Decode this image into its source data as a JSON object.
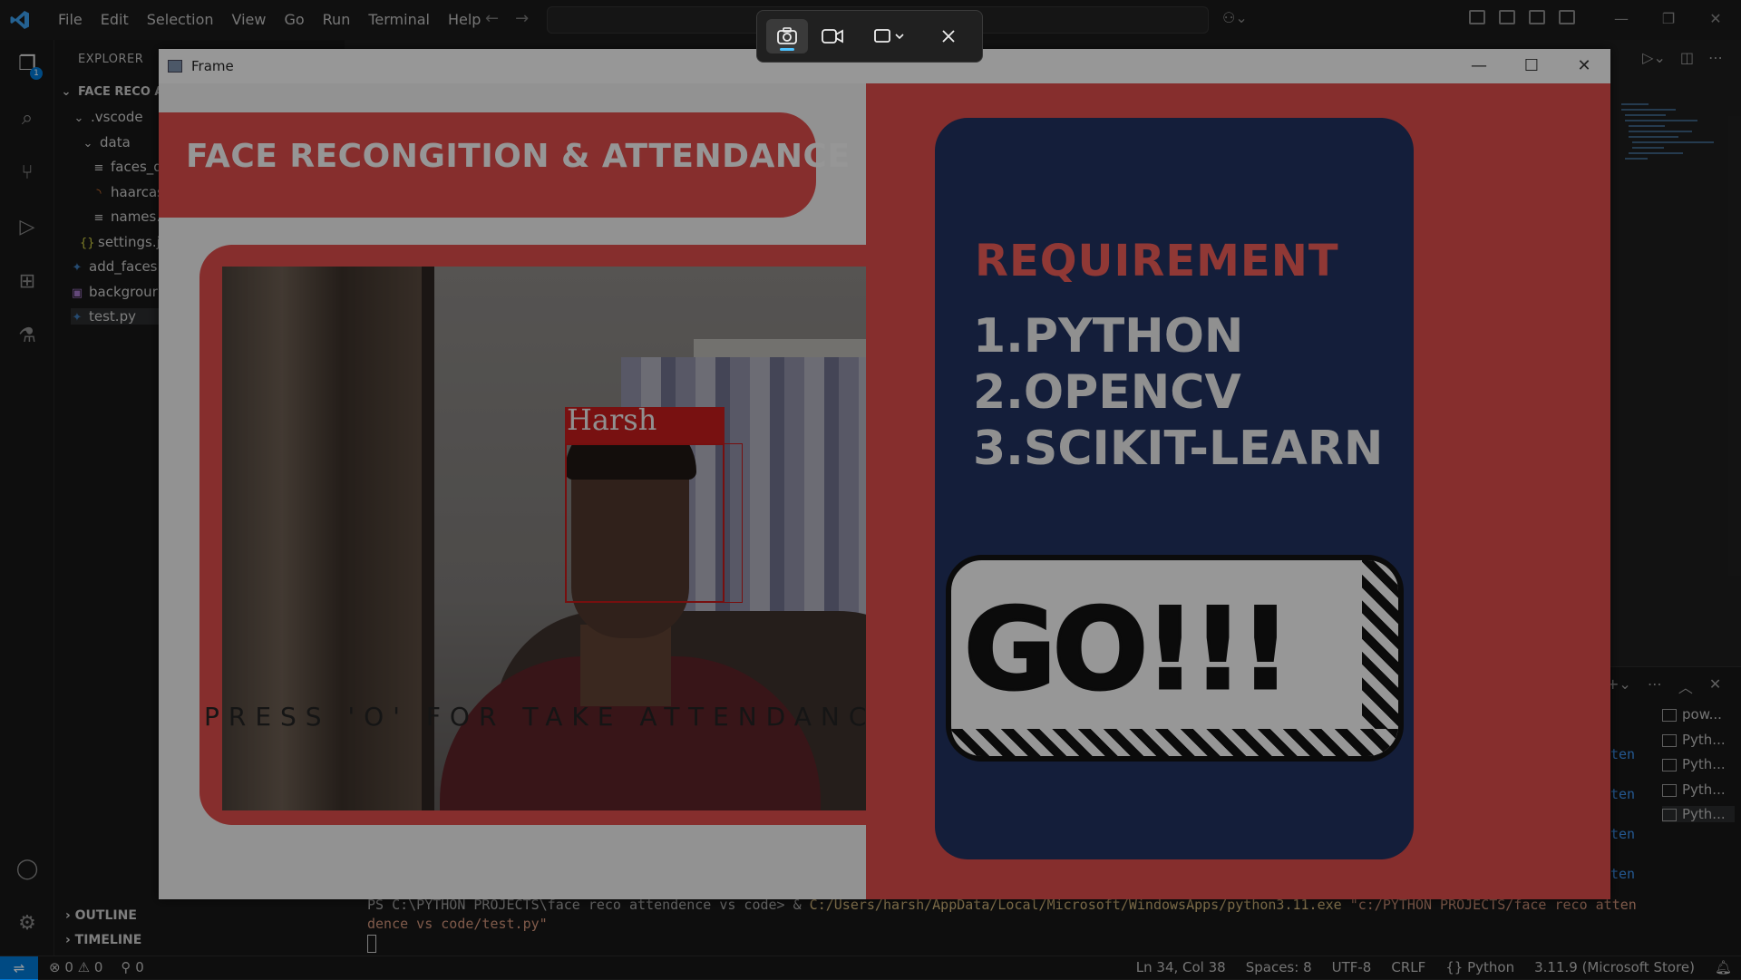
{
  "vscode": {
    "menu": [
      "File",
      "Edit",
      "Selection",
      "View",
      "Go",
      "Run",
      "Terminal",
      "Help"
    ],
    "explorer_header": "EXPLORER",
    "project_root": "FACE RECO AT",
    "tree": [
      {
        "label": ".vscode",
        "icon": "chevron-right"
      },
      {
        "label": "data",
        "icon": "chevron-down"
      },
      {
        "label": "faces_d",
        "icon": "text-file"
      },
      {
        "label": "haarcas",
        "icon": "rss-file"
      },
      {
        "label": "names.",
        "icon": "text-file"
      },
      {
        "label": "settings.j",
        "icon": "json-file"
      },
      {
        "label": "add_faces",
        "icon": "python-file"
      },
      {
        "label": "backgrour",
        "icon": "image-file"
      },
      {
        "label": "test.py",
        "icon": "python-file"
      }
    ],
    "outline_label": "OUTLINE",
    "timeline_label": "TIMELINE",
    "explorer_badge": "1",
    "terminal": {
      "prompt": "PS C:\\PYTHON PROJECTS\\face reco attendence vs code> &",
      "exe": "C:/Users/harsh/AppData/Local/Microsoft/WindowsApps/python3.11.exe",
      "arg_line1": "\"c:/PYTHON PROJECTS/face reco atten",
      "arg_line2": "dence vs code/test.py\"",
      "side_fragment": "ten",
      "tabs": [
        "pow...",
        "Pyth...",
        "Pyth...",
        "Pyth...",
        "Pyth..."
      ]
    },
    "status": {
      "errors": "0",
      "warnings": "0",
      "ports": "0",
      "position": "Ln 34, Col 38",
      "spaces": "Spaces: 8",
      "encoding": "UTF-8",
      "eol": "CRLF",
      "language": "Python",
      "interpreter": "3.11.9 (Microsoft Store)"
    }
  },
  "snip_toolbar": {
    "modes": [
      "camera-icon",
      "video-icon",
      "rectangle-select-icon",
      "close-icon"
    ]
  },
  "frame_window": {
    "title": "Frame",
    "banner_title": "FACE RECONGITION & ATTENDANCE",
    "detected_name": "Harsh",
    "instruction": "PRESS 'O' FOR TAKE ATTENDANCE",
    "requirement_title": "REQUIREMENT",
    "requirements": [
      "1.PYTHON",
      "2.OPENCV",
      "3.SCIKIT-LEARN"
    ],
    "go_text": "GO!!!"
  },
  "colors": {
    "accent_red": "#d84a48",
    "card_navy": "#20305e",
    "vscode_blue": "#0078d4",
    "detection_red": "#c21c1c"
  }
}
